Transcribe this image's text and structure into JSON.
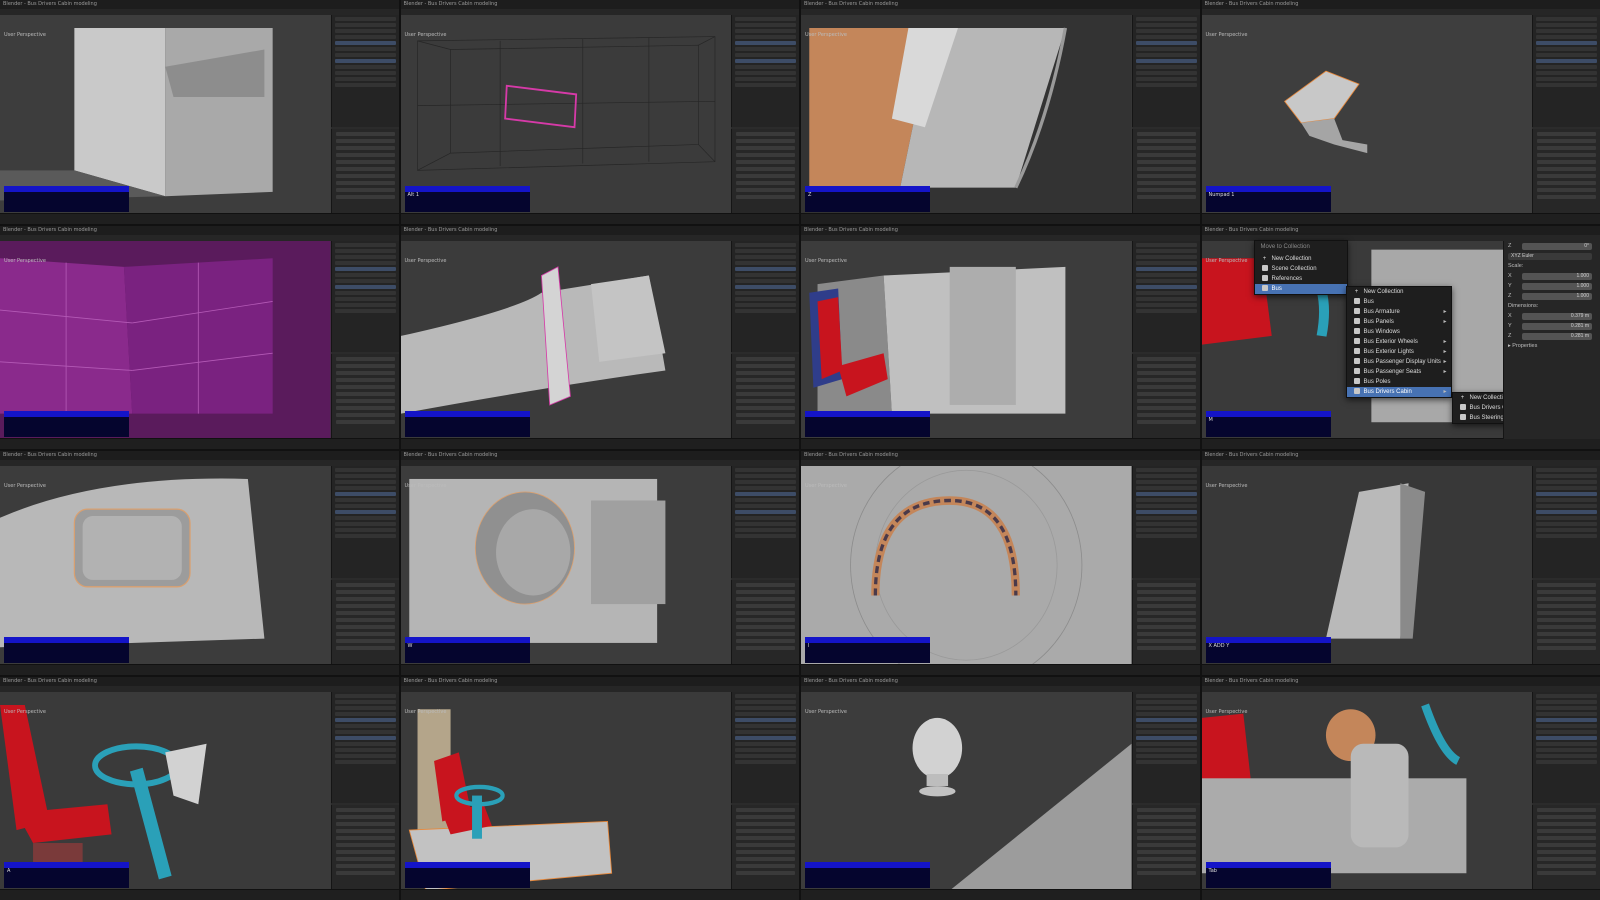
{
  "window_title": "Blender - Bus Drivers Cabin modeling",
  "tiles": [
    {
      "hud": "",
      "info": "User Perspective"
    },
    {
      "hud": "Alt 1",
      "info": "User Perspective"
    },
    {
      "hud": "Z",
      "info": "User Perspective"
    },
    {
      "hud": "Numpad 1",
      "info": "User Perspective"
    },
    {
      "hud": "",
      "info": "User Perspective"
    },
    {
      "hud": "",
      "info": "User Perspective"
    },
    {
      "hud": "",
      "info": "User Perspective"
    },
    {
      "hud": "M",
      "info": "User Perspective"
    },
    {
      "hud": "",
      "info": "User Perspective"
    },
    {
      "hud": "W",
      "info": "User Perspective"
    },
    {
      "hud": "I",
      "info": "User Perspective"
    },
    {
      "hud": "X ADD Y",
      "info": "User Perspective"
    },
    {
      "hud": "A",
      "info": "User Perspective"
    },
    {
      "hud": "",
      "info": "User Perspective"
    },
    {
      "hud": "",
      "info": "User Perspective"
    },
    {
      "hud": "Tab",
      "info": "User Perspective"
    }
  ],
  "move_menu": {
    "title": "Move to Collection",
    "items": [
      {
        "label": "New Collection",
        "icon": "plus-icon"
      },
      {
        "label": "Scene Collection",
        "icon": "collection-icon"
      },
      {
        "label": "References",
        "icon": "collection-icon"
      },
      {
        "label": "Bus",
        "icon": "collection-icon",
        "highlight": true
      }
    ]
  },
  "bus_menu": {
    "items": [
      {
        "label": "New Collection",
        "icon": "plus-icon"
      },
      {
        "label": "Bus",
        "icon": "collection-icon"
      },
      {
        "label": "Bus Armature",
        "icon": "collection-icon",
        "sub": true
      },
      {
        "label": "Bus Panels",
        "icon": "collection-icon",
        "sub": true
      },
      {
        "label": "Bus Windows",
        "icon": "collection-icon"
      },
      {
        "label": "Bus Exterior Wheels",
        "icon": "collection-icon",
        "sub": true
      },
      {
        "label": "Bus Exterior Lights",
        "icon": "collection-icon",
        "sub": true
      },
      {
        "label": "Bus Passenger Display Units",
        "icon": "collection-icon",
        "sub": true
      },
      {
        "label": "Bus Passenger Seats",
        "icon": "collection-icon",
        "sub": true
      },
      {
        "label": "Bus Poles",
        "icon": "collection-icon"
      },
      {
        "label": "Bus Drivers Cabin",
        "icon": "collection-icon",
        "sub": true,
        "highlight": true
      }
    ]
  },
  "cabin_menu": {
    "items": [
      {
        "label": "New Collection",
        "icon": "plus-icon"
      },
      {
        "label": "Bus Drivers Cabin",
        "icon": "collection-icon"
      },
      {
        "label": "Bus Steering Wheel",
        "icon": "collection-icon",
        "sub": true
      }
    ]
  },
  "transform_panel": {
    "rotation_mode": "XYZ Euler",
    "z_rotation": "0°",
    "scale_label": "Scale:",
    "scale": [
      {
        "axis": "X",
        "value": "1.000"
      },
      {
        "axis": "Y",
        "value": "1.000"
      },
      {
        "axis": "Z",
        "value": "1.000"
      }
    ],
    "dimensions_label": "Dimensions:",
    "dimensions": [
      {
        "axis": "X",
        "value": "0.379 m"
      },
      {
        "axis": "Y",
        "value": "0.281 m"
      },
      {
        "axis": "Z",
        "value": "0.281 m"
      }
    ],
    "properties_label": "Properties"
  },
  "colors": {
    "mesh": "#b9b9b9",
    "select_orange": "#e8883a",
    "selected_face": "#8a2a8c",
    "seat_red": "#c8141e",
    "steering_teal": "#2aa0b8",
    "menu_highlight": "#4772b3",
    "hud_blue": "#1414c8"
  }
}
